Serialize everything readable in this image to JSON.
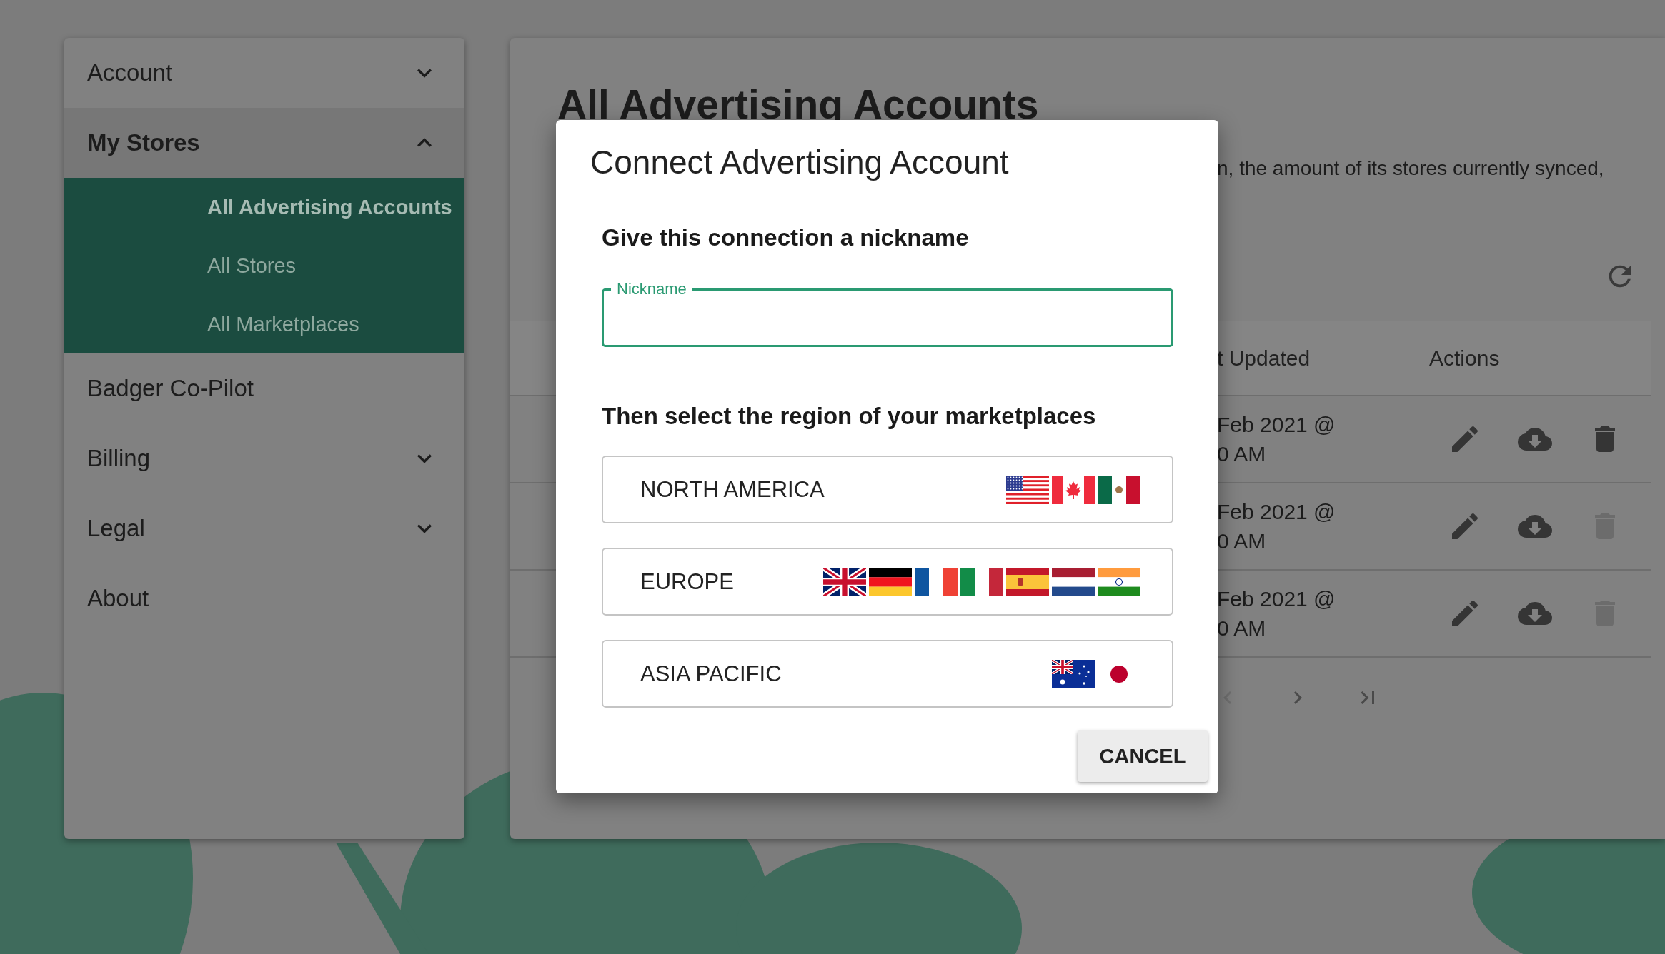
{
  "sidebar": {
    "items": [
      {
        "label": "Account",
        "kind": "group",
        "expanded": false
      },
      {
        "label": "My Stores",
        "kind": "group",
        "expanded": true,
        "children": [
          {
            "label": "All Advertising Accounts",
            "selected": true
          },
          {
            "label": "All Stores",
            "selected": false
          },
          {
            "label": "All Marketplaces",
            "selected": false
          }
        ]
      },
      {
        "label": "Badger Co-Pilot",
        "kind": "link"
      },
      {
        "label": "Billing",
        "kind": "group",
        "expanded": false
      },
      {
        "label": "Legal",
        "kind": "group",
        "expanded": false
      },
      {
        "label": "About",
        "kind": "link"
      }
    ]
  },
  "main": {
    "title": "All Advertising Accounts",
    "description": "n, the amount of its stores currently synced,",
    "table": {
      "columns": [
        "t Updated",
        "Actions"
      ],
      "rows": [
        {
          "last_updated": "Feb 2021 @\n0 AM",
          "delete_disabled": false
        },
        {
          "last_updated": "Feb 2021 @\n0 AM",
          "delete_disabled": true
        },
        {
          "last_updated": "Feb 2021 @\n0 AM",
          "delete_disabled": true
        }
      ]
    },
    "pagination": [
      {
        "kind": "prev",
        "disabled": true
      },
      {
        "kind": "next",
        "disabled": false
      },
      {
        "kind": "last",
        "disabled": false
      }
    ]
  },
  "dialog": {
    "title": "Connect Advertising Account",
    "nickname_heading": "Give this connection a nickname",
    "nickname_field": {
      "label": "Nickname",
      "focused": true
    },
    "region_heading": "Then select the region of your marketplaces",
    "regions": [
      {
        "label": "NORTH AMERICA",
        "flags": [
          {
            "kind": "us"
          },
          {
            "kind": "ca"
          },
          {
            "kind": "mx"
          }
        ]
      },
      {
        "label": "EUROPE",
        "flags": [
          {
            "kind": "uk"
          },
          {
            "kind": "de"
          },
          {
            "kind": "fr"
          },
          {
            "kind": "it"
          },
          {
            "kind": "es"
          },
          {
            "kind": "nl"
          },
          {
            "kind": "in"
          }
        ]
      },
      {
        "label": "ASIA PACIFIC",
        "flags": [
          {
            "kind": "au"
          },
          {
            "kind": "jp"
          }
        ]
      }
    ],
    "buttons": [
      "CANCEL"
    ]
  }
}
